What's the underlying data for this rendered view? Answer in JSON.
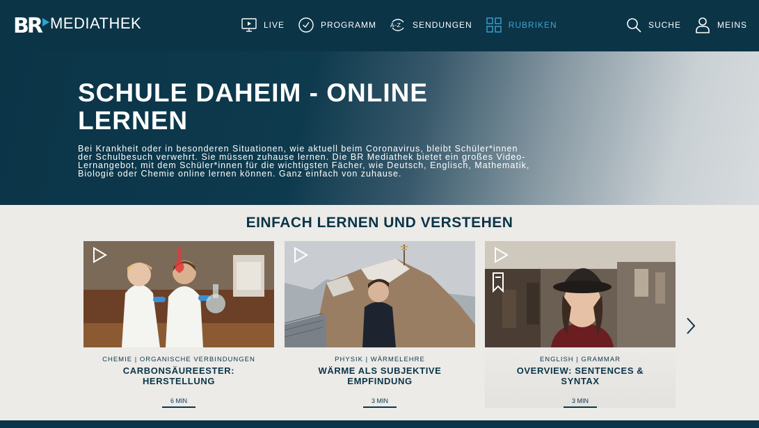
{
  "header": {
    "logo_letters": "BR",
    "logo_text": "MEDIATHEK",
    "nav": [
      {
        "label": "LIVE",
        "icon": "tv-play-icon"
      },
      {
        "label": "PROGRAMM",
        "icon": "clock-icon"
      },
      {
        "label": "SENDUNGEN",
        "icon": "a-z-icon"
      },
      {
        "label": "RUBRIKEN",
        "icon": "grid-icon",
        "active": true
      }
    ],
    "search_label": "SUCHE",
    "account_label": "MEINS"
  },
  "hero": {
    "title": "SCHULE DAHEIM - ONLINE LERNEN",
    "description": "Bei Krankheit oder in besonderen Situationen, wie aktuell beim Coronavirus, bleibt Schüler*innen der Schulbesuch verwehrt. Sie müssen zuhause lernen. Die BR Mediathek bietet ein großes Video-Lernangebot, mit dem Schüler*innen für die wichtigsten Fächer, wie Deutsch, Englisch, Mathematik, Biologie oder Chemie online lernen können. Ganz einfach von zuhause."
  },
  "section": {
    "title": "EINFACH LERNEN UND VERSTEHEN",
    "cards": [
      {
        "meta": "CHEMIE | ORGANISCHE VERBINDUNGEN",
        "title": "CARBONSÄUREESTER: HERSTELLUNG",
        "duration": "6 MIN"
      },
      {
        "meta": "PHYSIK | WÄRMELEHRE",
        "title": "WÄRME ALS SUBJEKTIVE EMPFINDUNG",
        "duration": "3 MIN"
      },
      {
        "meta": "ENGLISH | GRAMMAR",
        "title": "OVERVIEW: SENTENCES & SYNTAX",
        "duration": "3 MIN"
      }
    ]
  },
  "colors": {
    "brand": "#0b3447",
    "accent": "#3ea3d2",
    "background": "#ecebe8"
  }
}
